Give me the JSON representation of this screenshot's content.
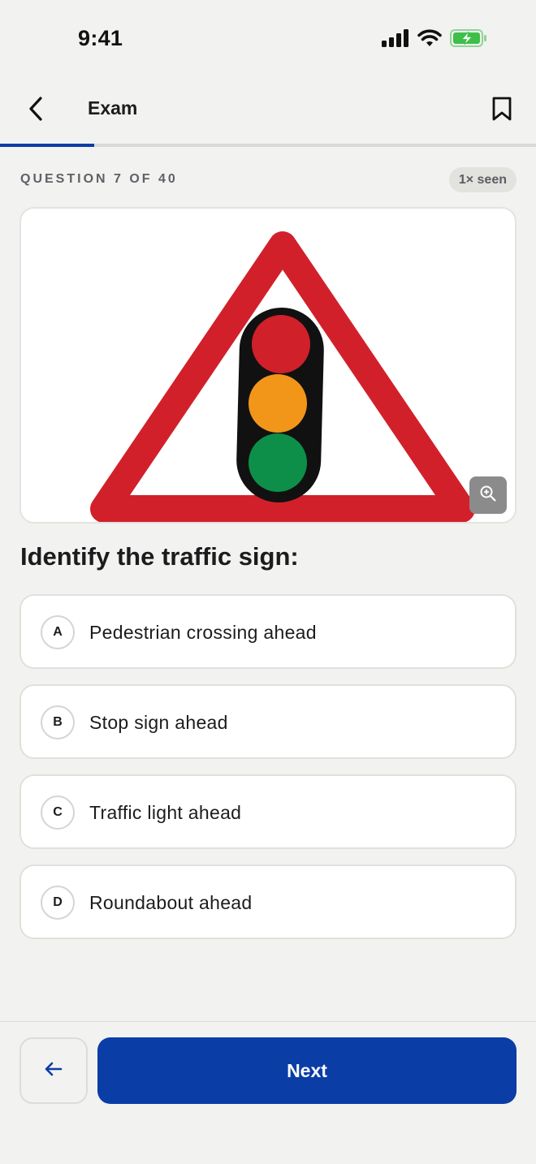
{
  "status_bar": {
    "time": "9:41",
    "icons": [
      "cellular-signal-icon",
      "wifi-icon",
      "battery-charging-icon"
    ]
  },
  "nav": {
    "title": "Exam",
    "back_icon": "chevron-left-icon",
    "bookmark_icon": "bookmark-icon"
  },
  "progress": {
    "current": 7,
    "total": 40,
    "fraction": 0.175
  },
  "question": {
    "counter": "QUESTION 7 OF 40",
    "seen_badge": "1× seen",
    "prompt": "Identify the traffic sign:",
    "image": {
      "subject": "traffic-signals-warning-sign",
      "colors": {
        "border": "#d2202a",
        "housing": "#111111",
        "red": "#d0202a",
        "amber": "#f29619",
        "green": "#0d8f4a"
      }
    },
    "zoom_icon": "zoom-in-icon"
  },
  "options": [
    {
      "letter": "A",
      "label": "Pedestrian crossing ahead"
    },
    {
      "letter": "B",
      "label": "Stop sign ahead"
    },
    {
      "letter": "C",
      "label": "Traffic light ahead"
    },
    {
      "letter": "D",
      "label": "Roundabout ahead"
    }
  ],
  "footer": {
    "prev_icon": "arrow-left-icon",
    "next_label": "Next"
  },
  "colors": {
    "accent": "#0a3da6",
    "background": "#f2f2f0",
    "battery_green": "#3dbf4a"
  }
}
